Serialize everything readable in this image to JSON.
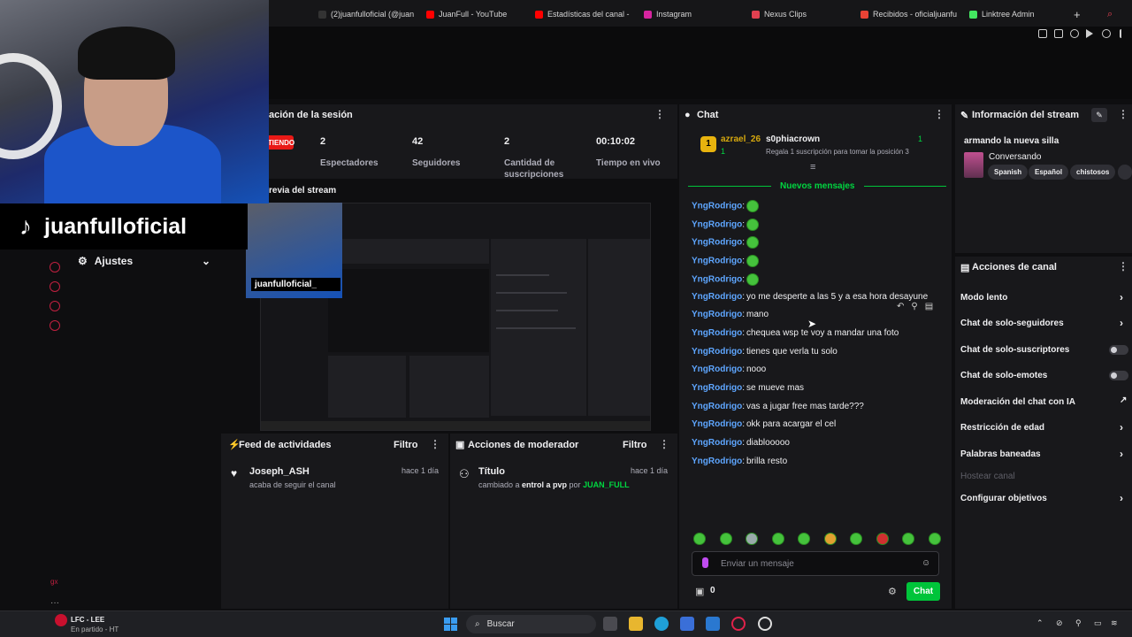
{
  "browser": {
    "tabs": [
      {
        "label": "(2)juanfulloficial (@juan",
        "color": "#111111"
      },
      {
        "label": "JuanFull - YouTube",
        "color": "#ff0000"
      },
      {
        "label": "Estadísticas del canal -",
        "color": "#ff0000"
      },
      {
        "label": "Instagram",
        "color": "#d6249f"
      },
      {
        "label": "Nexus Clips",
        "color": "#e04050"
      },
      {
        "label": "Recibidos - oficialjuanfu",
        "color": "#ea4335"
      },
      {
        "label": "Linktree Admin",
        "color": "#43e660"
      }
    ],
    "new_tab": "+"
  },
  "overlay": {
    "tiktok_handle": "juanfulloficial",
    "mini_handle": "juanfulloficial_"
  },
  "sidebar": {
    "ajustes_label": "Ajustes",
    "bottom_label": "gx"
  },
  "session": {
    "title": "ación de la sesión",
    "live_badge": "TIENDO",
    "stats": [
      {
        "value": "2",
        "label": "Espectadores"
      },
      {
        "value": "42",
        "label": "Seguidores"
      },
      {
        "value": "2",
        "label": "Cantidad de suscripciones"
      },
      {
        "value": "00:10:02",
        "label": "Tiempo en vivo"
      }
    ]
  },
  "preview": {
    "title": "revia del stream"
  },
  "feed": {
    "title": "Feed de actividades",
    "filter": "Filtro",
    "items": [
      {
        "name": "Joseph_ASH",
        "desc": "acaba de seguir el canal",
        "time": "hace 1 día"
      }
    ]
  },
  "moderator": {
    "title": "Acciones de moderador",
    "filter": "Filtro",
    "items": [
      {
        "name": "Título",
        "desc_a": "cambiado a ",
        "desc_b": "entrol a pvp",
        "desc_c": " por ",
        "desc_d": "JUAN_FULL",
        "time": "hace 1 día"
      }
    ]
  },
  "chat": {
    "title": "Chat",
    "leaderboard": {
      "rank": "1",
      "user": "azrael_26",
      "user_sub": "1",
      "gifter": "s0phiacrown",
      "gifter_count": "1",
      "gift_text": "Regala 1 suscripción para tomar la posición 3"
    },
    "new_messages": "Nuevos mensajes",
    "messages": [
      {
        "user": "YngRodrigo",
        "text": "",
        "emote": true
      },
      {
        "user": "YngRodrigo",
        "text": "",
        "emote": true
      },
      {
        "user": "YngRodrigo",
        "text": "",
        "emote": true
      },
      {
        "user": "YngRodrigo",
        "text": "",
        "emote": true
      },
      {
        "user": "YngRodrigo",
        "text": "",
        "emote": true
      },
      {
        "user": "YngRodrigo",
        "text": "yo me desperte a las 5 y a esa hora desayune",
        "emote": false
      },
      {
        "user": "YngRodrigo",
        "text": "mano",
        "emote": false
      },
      {
        "user": "YngRodrigo",
        "text": "chequea wsp te voy a mandar una foto",
        "emote": false
      },
      {
        "user": "YngRodrigo",
        "text": "tienes que verla tu solo",
        "emote": false
      },
      {
        "user": "YngRodrigo",
        "text": "nooo",
        "emote": false
      },
      {
        "user": "YngRodrigo",
        "text": "se mueve mas",
        "emote": false
      },
      {
        "user": "YngRodrigo",
        "text": "vas a jugar free mas tarde???",
        "emote": false
      },
      {
        "user": "YngRodrigo",
        "text": "okk para acargar el cel",
        "emote": false
      },
      {
        "user": "YngRodrigo",
        "text": "diablooooo",
        "emote": false
      },
      {
        "user": "YngRodrigo",
        "text": "brilla resto",
        "emote": false
      }
    ],
    "input_placeholder": "Enviar un mensaje",
    "points": "0",
    "send_label": "Chat"
  },
  "stream_info": {
    "title": "Información del stream",
    "stream_title": "armando la nueva silla",
    "category": "Conversando",
    "tags": [
      "Spanish",
      "Español",
      "chistosos"
    ]
  },
  "channel_actions": {
    "title": "Acciones de canal",
    "rows": [
      {
        "label": "Modo lento",
        "control": "chevron"
      },
      {
        "label": "Chat de solo-seguidores",
        "control": "chevron"
      },
      {
        "label": "Chat de solo-suscriptores",
        "control": "toggle"
      },
      {
        "label": "Chat de solo-emotes",
        "control": "toggle"
      },
      {
        "label": "Moderación del chat con IA",
        "control": "external"
      },
      {
        "label": "Restricción de edad",
        "control": "chevron"
      },
      {
        "label": "Palabras baneadas",
        "control": "chevron"
      },
      {
        "label": "Hostear canal",
        "control": "none"
      },
      {
        "label": "Configurar objetivos",
        "control": "chevron"
      }
    ]
  },
  "taskbar": {
    "weather_title": "LFC - LEE",
    "weather_sub": "En partido - HT",
    "search_label": "Buscar"
  },
  "colors": {
    "accent": "#00c43a",
    "username": "#5ea6ff",
    "live": "#e91916"
  }
}
